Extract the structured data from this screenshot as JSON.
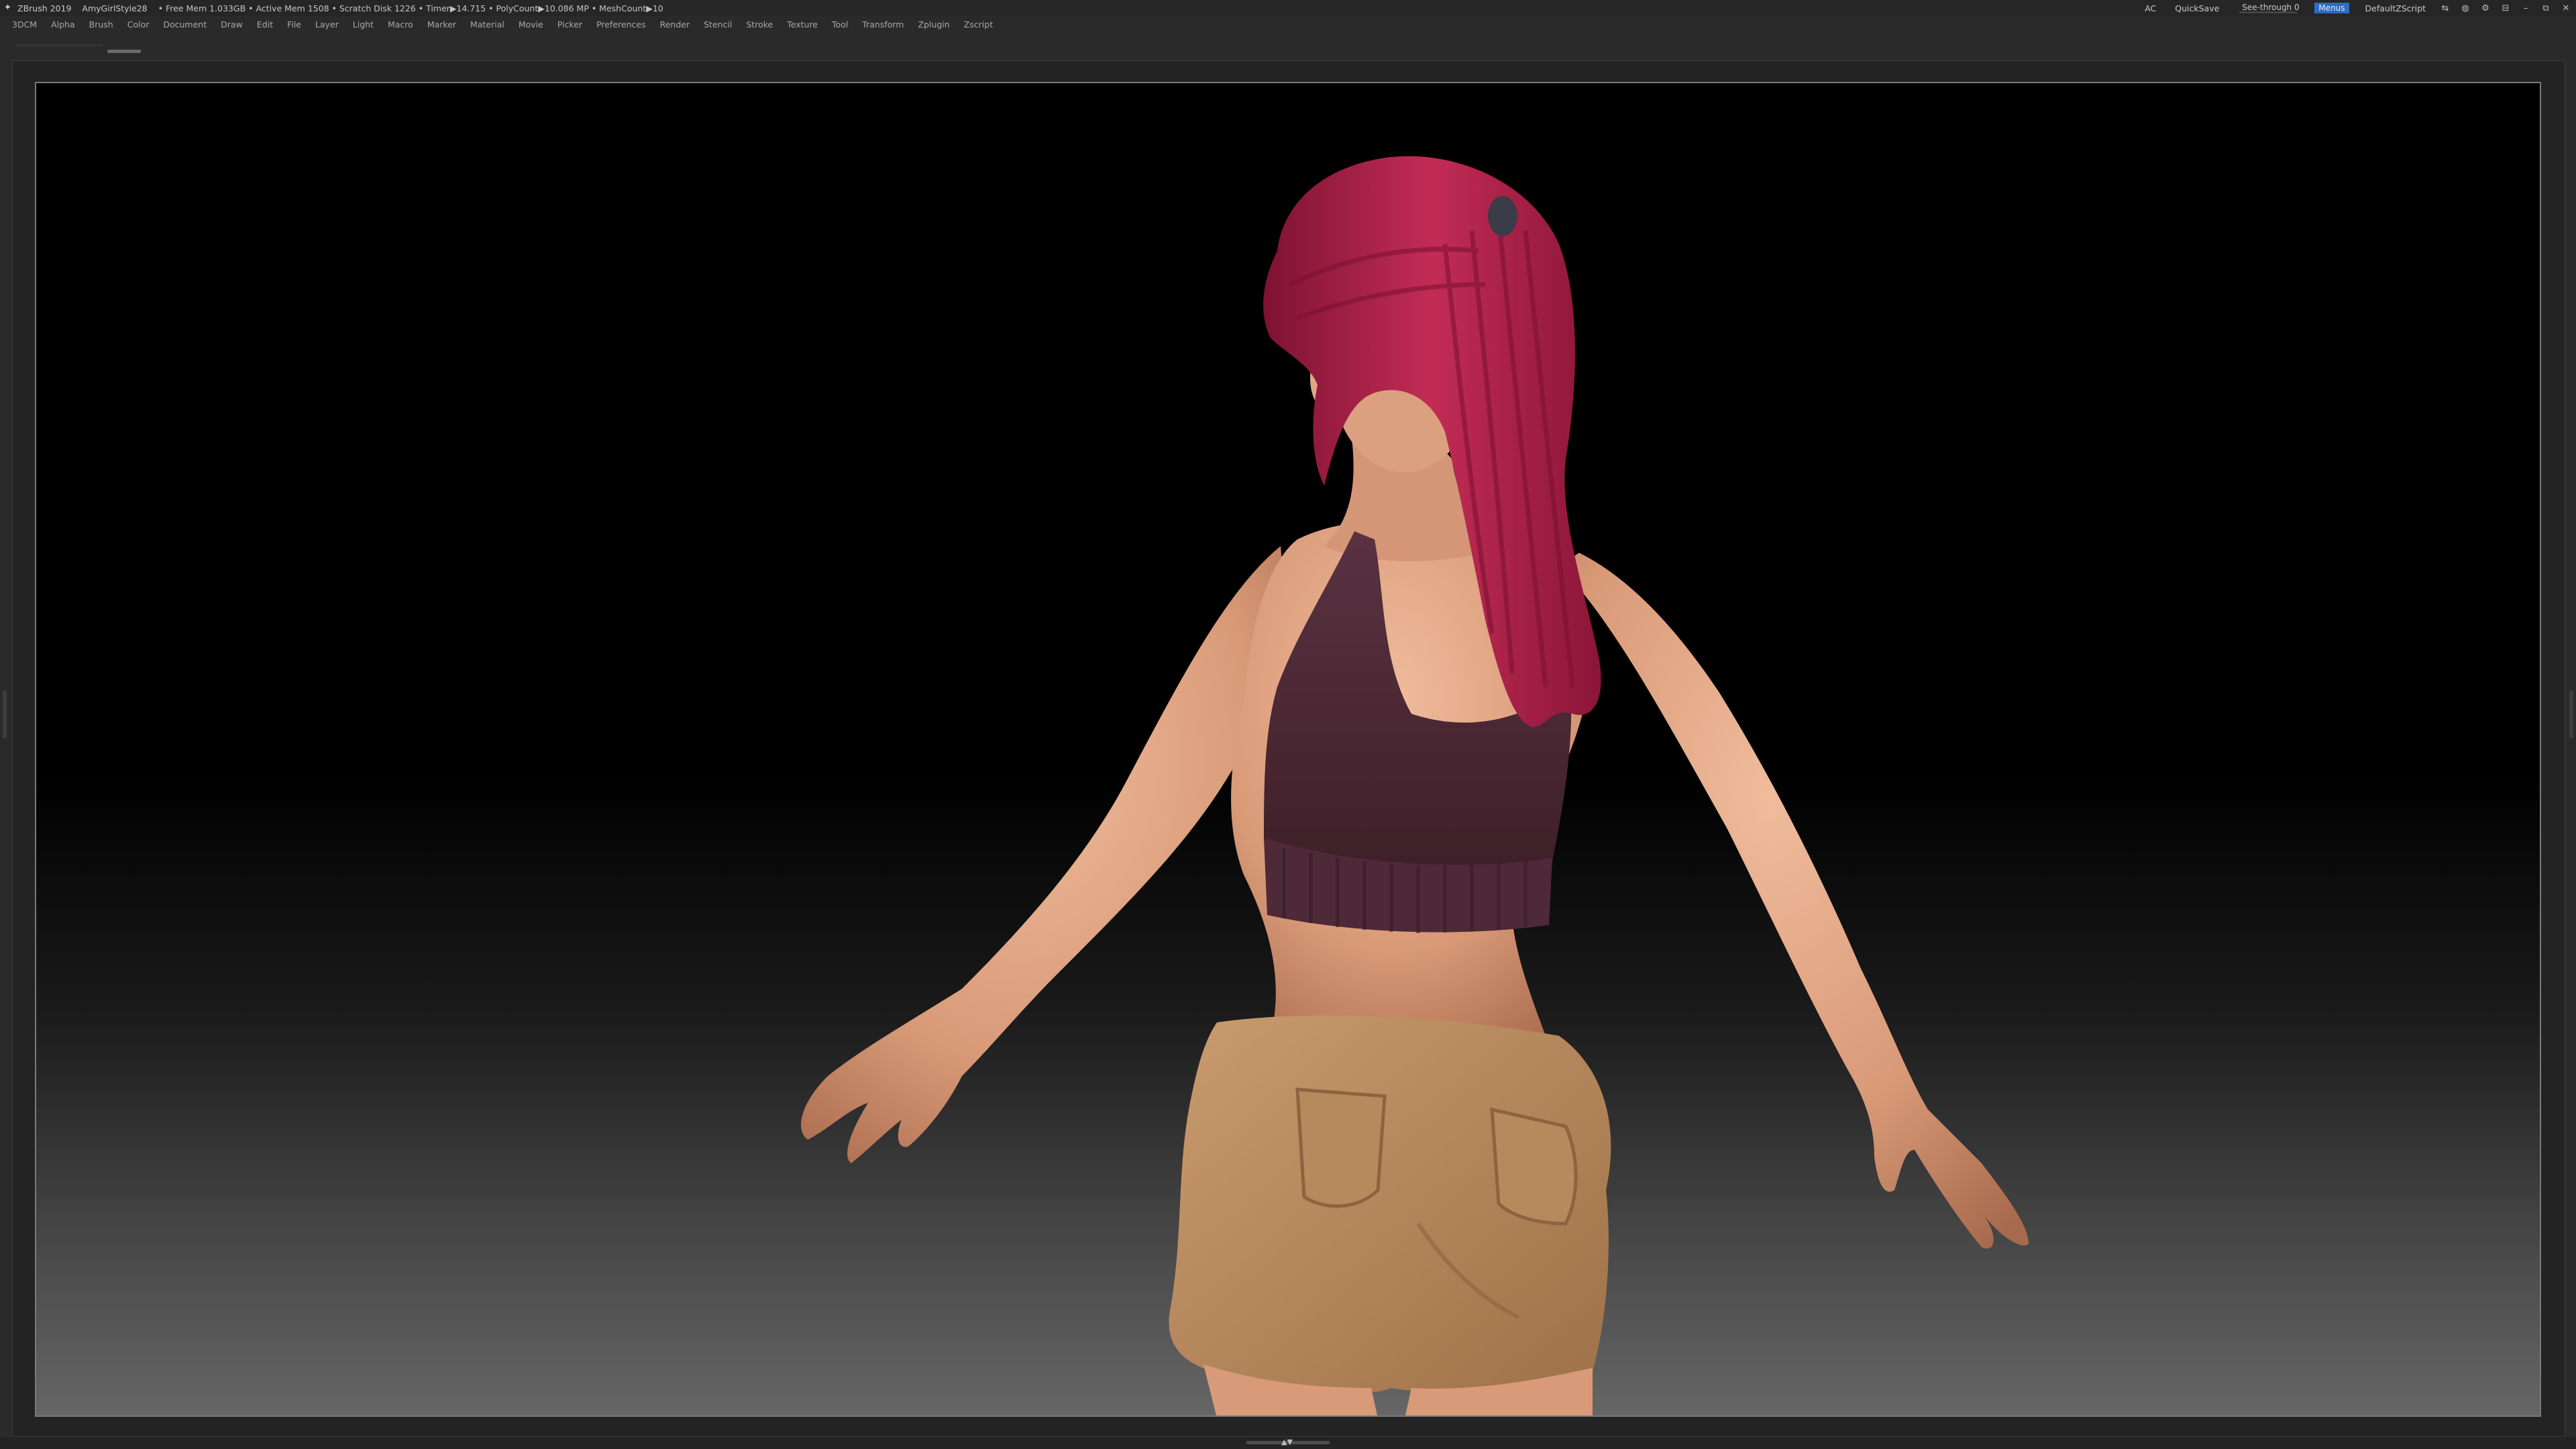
{
  "titlebar": {
    "app_name": "ZBrush 2019",
    "project": "AmyGirlStyle28",
    "stats": "• Free Mem 1.033GB • Active Mem 1508 • Scratch Disk 1226 • Timer▶14.715 • PolyCount▶10.086 MP • MeshCount▶10",
    "ac_label": "AC",
    "quicksave_label": "QuickSave",
    "seethrough_label": "See-through  0",
    "seethrough_value": 0,
    "menus_label": "Menus",
    "script_label": "DefaultZScript"
  },
  "menubar": {
    "items": [
      "3DCM",
      "Alpha",
      "Brush",
      "Color",
      "Document",
      "Draw",
      "Edit",
      "File",
      "Layer",
      "Light",
      "Macro",
      "Marker",
      "Material",
      "Movie",
      "Picker",
      "Preferences",
      "Render",
      "Stencil",
      "Stroke",
      "Texture",
      "Tool",
      "Transform",
      "Zplugin",
      "Zscript"
    ]
  },
  "colors": {
    "accent_blue": "#2d6cc7",
    "slider_orange": "#d07a2a",
    "hair": "#b0204a",
    "skin": "#e0a585",
    "top": "#4c2a36",
    "shorts": "#b88a5c"
  },
  "icons": [
    "zbrush-logo-icon",
    "layout-icon",
    "help-icon",
    "settings-icon",
    "lock-icon",
    "minimize-icon",
    "restore-icon",
    "close-icon"
  ]
}
